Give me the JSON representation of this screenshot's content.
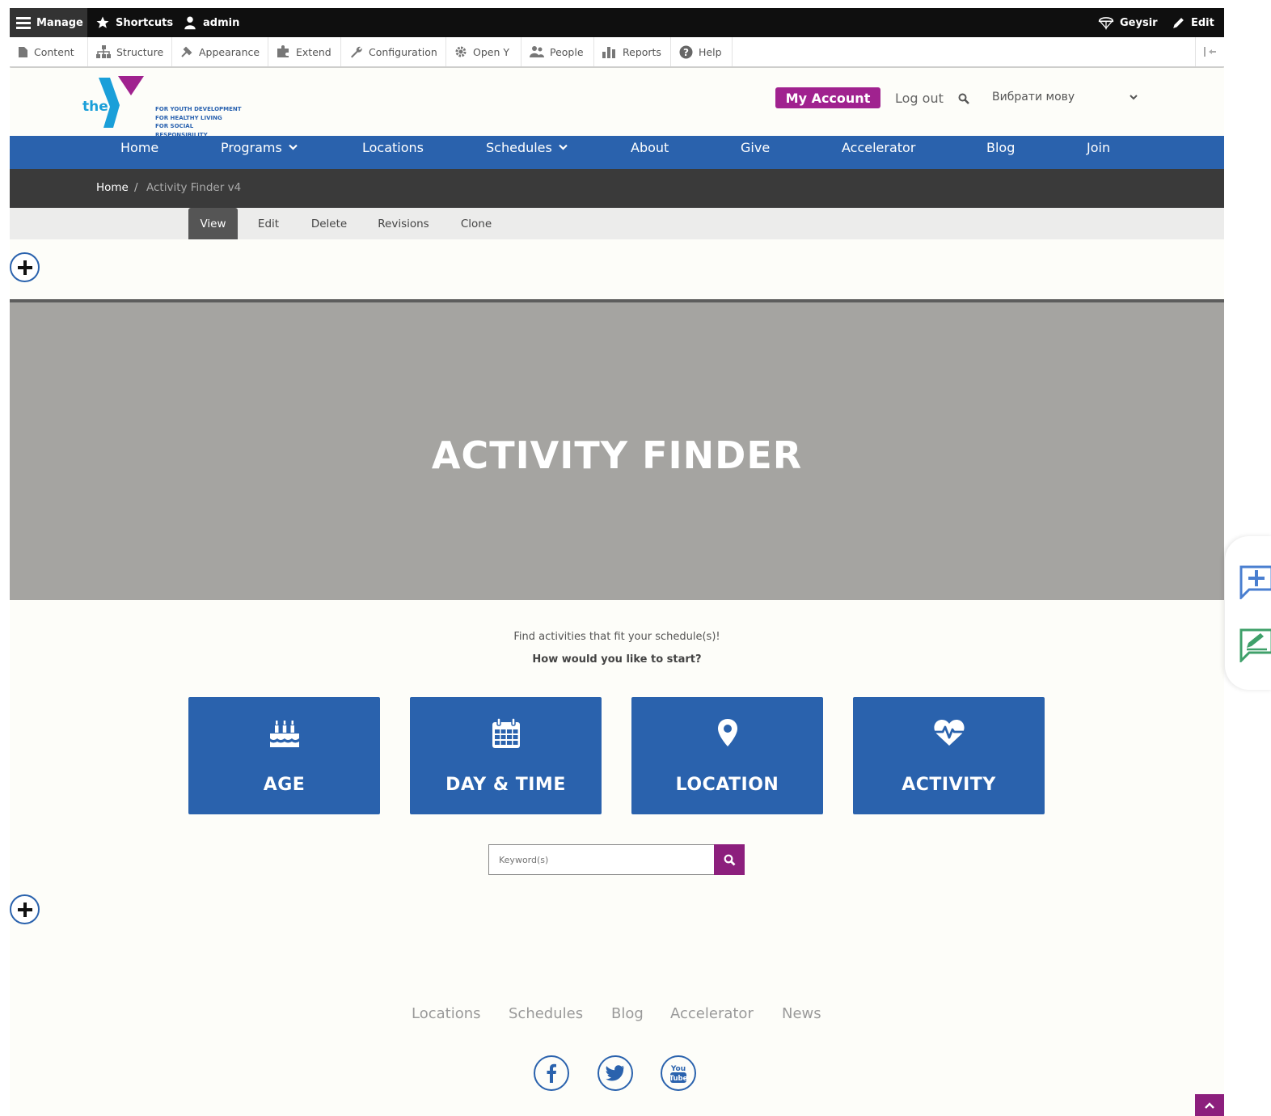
{
  "admin_toolbar": {
    "manage": "Manage",
    "shortcuts": "Shortcuts",
    "user": "admin",
    "theme": "Geysir",
    "edit": "Edit"
  },
  "admin_menu": [
    {
      "label": "Content",
      "icon": "file-icon"
    },
    {
      "label": "Structure",
      "icon": "sitemap-icon"
    },
    {
      "label": "Appearance",
      "icon": "brush-icon"
    },
    {
      "label": "Extend",
      "icon": "puzzle-icon"
    },
    {
      "label": "Configuration",
      "icon": "wrench-icon"
    },
    {
      "label": "Open Y",
      "icon": "gear-icon"
    },
    {
      "label": "People",
      "icon": "people-icon"
    },
    {
      "label": "Reports",
      "icon": "bar-chart-icon"
    },
    {
      "label": "Help",
      "icon": "help-icon"
    }
  ],
  "header": {
    "logo_the": "the",
    "logo_taglines": [
      "FOR YOUTH DEVELOPMENT",
      "FOR HEALTHY LIVING",
      "FOR SOCIAL RESPONSIBILITY"
    ],
    "my_account": "My Account",
    "logout": "Log out",
    "language_placeholder": "Вибрати мову"
  },
  "nav": [
    {
      "label": "Home",
      "dropdown": false
    },
    {
      "label": "Programs",
      "dropdown": true
    },
    {
      "label": "Locations",
      "dropdown": false
    },
    {
      "label": "Schedules",
      "dropdown": true
    },
    {
      "label": "About",
      "dropdown": false
    },
    {
      "label": "Give",
      "dropdown": false
    },
    {
      "label": "Accelerator",
      "dropdown": false
    },
    {
      "label": "Blog",
      "dropdown": false
    },
    {
      "label": "Join",
      "dropdown": false
    }
  ],
  "breadcrumb": {
    "home": "Home",
    "separator": "/",
    "current": "Activity Finder v4"
  },
  "tabs": [
    "View",
    "Edit",
    "Delete",
    "Revisions",
    "Clone"
  ],
  "active_tab": "View",
  "banner": {
    "title": "ACTIVITY FINDER"
  },
  "intro": {
    "line1": "Find activities that fit your schedule(s)!",
    "line2": "How would you like to start?"
  },
  "cards": [
    {
      "label": "AGE",
      "icon": "birthday-cake-icon"
    },
    {
      "label": "DAY & TIME",
      "icon": "calendar-icon"
    },
    {
      "label": "LOCATION",
      "icon": "map-pin-icon"
    },
    {
      "label": "ACTIVITY",
      "icon": "heartbeat-icon"
    }
  ],
  "search": {
    "placeholder": "Keyword(s)"
  },
  "footer": {
    "links": [
      "Locations",
      "Schedules",
      "Blog",
      "Accelerator",
      "News"
    ],
    "social": [
      "facebook-icon",
      "twitter-icon",
      "youtube-icon"
    ],
    "youtube_text": [
      "You",
      "Tube"
    ]
  },
  "colors": {
    "brand_blue": "#2a62ad",
    "brand_purple": "#a0228f",
    "search_purple": "#8c1f7d",
    "toolbar_black": "#0f0f0f",
    "breadcrumb_bg": "#3a3a3a",
    "banner_gray": "#a5a4a1"
  }
}
